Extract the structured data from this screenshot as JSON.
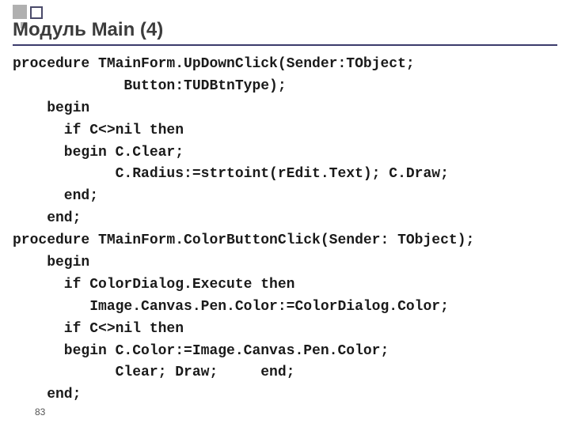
{
  "title": "Модуль Main (4)",
  "page_number": "83",
  "code": {
    "l01": "procedure TMainForm.UpDownClick(Sender:TObject;",
    "l02": "             Button:TUDBtnType);",
    "l03": "    begin",
    "l04": "      if C<>nil then",
    "l05": "      begin C.Clear;",
    "l06": "            C.Radius:=strtoint(rEdit.Text); C.Draw;",
    "l07": "      end;",
    "l08": "    end;",
    "l09": "procedure TMainForm.ColorButtonClick(Sender: TObject);",
    "l10": "    begin",
    "l11": "      if ColorDialog.Execute then",
    "l12": "         Image.Canvas.Pen.Color:=ColorDialog.Color;",
    "l13": "      if C<>nil then",
    "l14": "      begin C.Color:=Image.Canvas.Pen.Color;",
    "l15": "            Clear; Draw;     end;",
    "l16": "    end;"
  }
}
